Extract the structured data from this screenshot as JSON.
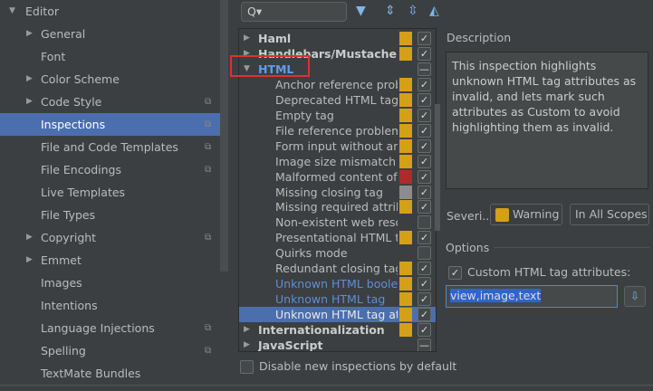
{
  "sidebar": {
    "items": [
      {
        "label": "Editor",
        "arrow": "▼",
        "level": 0
      },
      {
        "label": "General",
        "arrow": "▶"
      },
      {
        "label": "Font"
      },
      {
        "label": "Color Scheme",
        "arrow": "▶"
      },
      {
        "label": "Code Style",
        "arrow": "▶",
        "copy": true
      },
      {
        "label": "Inspections",
        "copy": true,
        "selected": true
      },
      {
        "label": "File and Code Templates",
        "copy": true
      },
      {
        "label": "File Encodings",
        "copy": true
      },
      {
        "label": "Live Templates"
      },
      {
        "label": "File Types"
      },
      {
        "label": "Copyright",
        "arrow": "▶",
        "copy": true
      },
      {
        "label": "Emmet",
        "arrow": "▶"
      },
      {
        "label": "Images"
      },
      {
        "label": "Intentions"
      },
      {
        "label": "Language Injections",
        "copy": true
      },
      {
        "label": "Spelling",
        "copy": true
      },
      {
        "label": "TextMate Bundles"
      }
    ]
  },
  "toolbar": {
    "search_placeholder": "Q▾"
  },
  "tree": {
    "rows": [
      {
        "label": "Haml",
        "group": true,
        "arrow": "▶",
        "color": "#d4a017",
        "check": "✓"
      },
      {
        "label": "Handlebars/Mustache",
        "group": true,
        "arrow": "▶",
        "color": "#d4a017",
        "check": "✓"
      },
      {
        "label": "HTML",
        "group": true,
        "arrow": "▼",
        "check": "—",
        "blue": true
      },
      {
        "label": "Anchor reference problems",
        "color": "#d4a017",
        "check": "✓"
      },
      {
        "label": "Deprecated HTML tag",
        "color": "#d4a017",
        "check": "✓"
      },
      {
        "label": "Empty tag",
        "color": "#d4a017",
        "check": "✓"
      },
      {
        "label": "File reference problems",
        "color": "#d4a017",
        "check": "✓"
      },
      {
        "label": "Form input without an associated label",
        "color": "#d4a017",
        "check": "✓"
      },
      {
        "label": "Image size mismatch",
        "color": "#d4a017",
        "check": "✓"
      },
      {
        "label": "Malformed content of",
        "color": "#b02a2a",
        "check": "✓"
      },
      {
        "label": "Missing closing tag",
        "color": "#8c8c8c",
        "check": "✓"
      },
      {
        "label": "Missing required attribute",
        "color": "#d4a017",
        "check": "✓"
      },
      {
        "label": "Non-existent web resource",
        "check": ""
      },
      {
        "label": "Presentational HTML tag",
        "color": "#d4a017",
        "check": "✓"
      },
      {
        "label": "Quirks mode",
        "check": ""
      },
      {
        "label": "Redundant closing tag",
        "color": "#d4a017",
        "check": "✓"
      },
      {
        "label": "Unknown HTML boolean attribute",
        "color": "#d4a017",
        "check": "✓",
        "link": true
      },
      {
        "label": "Unknown HTML tag",
        "color": "#d4a017",
        "check": "✓",
        "link": true
      },
      {
        "label": "Unknown HTML tag attribute",
        "color": "#d4a017",
        "check": "✓",
        "selected": true
      },
      {
        "label": "Internationalization",
        "group": true,
        "arrow": "▶",
        "color": "#d4a017",
        "check": "✓"
      },
      {
        "label": "JavaScript",
        "group": true,
        "arrow": "▶",
        "check": "—"
      }
    ]
  },
  "disable_label": "Disable new inspections by default",
  "description": {
    "label": "Description",
    "text": "This inspection highlights unknown HTML tag attributes as invalid, and lets mark such attributes as Custom to avoid highlighting them as invalid."
  },
  "severity": {
    "label": "Severi...",
    "value": "Warning",
    "color": "#d4a017",
    "scope": "In All Scopes"
  },
  "options": {
    "label": "Options",
    "custom_label": "Custom HTML tag attributes:",
    "custom_checked": true,
    "attributes_value": "view,image,text"
  }
}
